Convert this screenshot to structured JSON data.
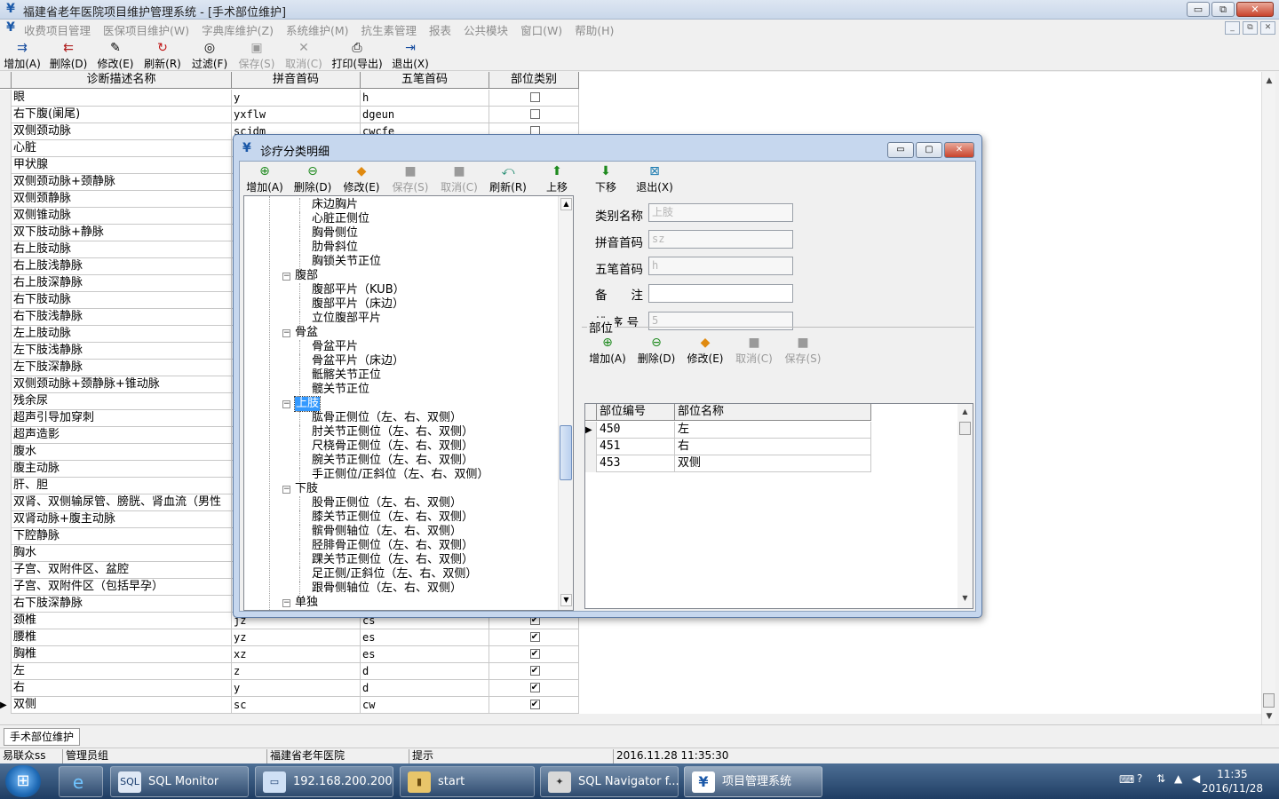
{
  "window": {
    "title": "福建省老年医院项目维护管理系统 - [手术部位维护]",
    "controls": [
      "▭",
      "⧉",
      "✕"
    ]
  },
  "menu": {
    "items": [
      "收费项目管理",
      "医保项目维护(W)",
      "字典库维护(Z)",
      "系统维护(M)",
      "抗生素管理",
      "报表",
      "公共模块",
      "窗口(W)",
      "帮助(H)"
    ],
    "mdi_controls": [
      "_",
      "⧉",
      "✕"
    ]
  },
  "toolbar": {
    "add": "增加(A)",
    "delete": "删除(D)",
    "edit": "修改(E)",
    "refresh": "刷新(R)",
    "filter": "过滤(F)",
    "save": "保存(S)",
    "cancel": "取消(C)",
    "print": "打印(导出)",
    "exit": "退出(X)"
  },
  "main_grid": {
    "columns": [
      "诊断描述名称",
      "拼音首码",
      "五笔首码",
      "部位类别"
    ],
    "rows": [
      {
        "name": "眼",
        "py": "y",
        "wb": "h",
        "checked": false
      },
      {
        "name": "右下腹(阑尾)",
        "py": "yxflw",
        "wb": "dgeun",
        "checked": false
      },
      {
        "name": "双侧颈动脉",
        "py": "scjdm",
        "wb": "cwcfe",
        "checked": false
      },
      {
        "name": "心脏",
        "py": "",
        "wb": "",
        "checked": false
      },
      {
        "name": "甲状腺",
        "py": "",
        "wb": "",
        "checked": false
      },
      {
        "name": "双侧颈动脉+颈静脉",
        "py": "",
        "wb": "",
        "checked": false
      },
      {
        "name": "双侧颈静脉",
        "py": "",
        "wb": "",
        "checked": false
      },
      {
        "name": "双侧锥动脉",
        "py": "",
        "wb": "",
        "checked": false
      },
      {
        "name": "双下肢动脉+静脉",
        "py": "",
        "wb": "",
        "checked": false
      },
      {
        "name": "右上肢动脉",
        "py": "",
        "wb": "",
        "checked": false
      },
      {
        "name": "右上肢浅静脉",
        "py": "",
        "wb": "",
        "checked": false
      },
      {
        "name": "右上肢深静脉",
        "py": "",
        "wb": "",
        "checked": false
      },
      {
        "name": "右下肢动脉",
        "py": "",
        "wb": "",
        "checked": false
      },
      {
        "name": "右下肢浅静脉",
        "py": "",
        "wb": "",
        "checked": false
      },
      {
        "name": "左上肢动脉",
        "py": "",
        "wb": "",
        "checked": false
      },
      {
        "name": "左下肢浅静脉",
        "py": "",
        "wb": "",
        "checked": false
      },
      {
        "name": "左下肢深静脉",
        "py": "",
        "wb": "",
        "checked": false
      },
      {
        "name": "双侧颈动脉+颈静脉+锥动脉",
        "py": "",
        "wb": "",
        "checked": false
      },
      {
        "name": "残余尿",
        "py": "",
        "wb": "",
        "checked": false
      },
      {
        "name": "超声引导加穿刺",
        "py": "",
        "wb": "",
        "checked": false
      },
      {
        "name": "超声造影",
        "py": "",
        "wb": "",
        "checked": false
      },
      {
        "name": "腹水",
        "py": "",
        "wb": "",
        "checked": false
      },
      {
        "name": "腹主动脉",
        "py": "",
        "wb": "",
        "checked": false
      },
      {
        "name": "肝、胆",
        "py": "",
        "wb": "",
        "checked": false
      },
      {
        "name": "双肾、双侧输尿管、膀胱、肾血流（男性",
        "py": "",
        "wb": "",
        "checked": false
      },
      {
        "name": "双肾动脉+腹主动脉",
        "py": "",
        "wb": "",
        "checked": false
      },
      {
        "name": "下腔静脉",
        "py": "",
        "wb": "",
        "checked": false
      },
      {
        "name": "胸水",
        "py": "",
        "wb": "",
        "checked": false
      },
      {
        "name": "子宫、双附件区、盆腔",
        "py": "",
        "wb": "",
        "checked": false
      },
      {
        "name": "子宫、双附件区（包括早孕）",
        "py": "",
        "wb": "",
        "checked": false
      },
      {
        "name": "右下肢深静脉",
        "py": "",
        "wb": "",
        "checked": false
      },
      {
        "name": "颈椎",
        "py": "jz",
        "wb": "cs",
        "checked": true
      },
      {
        "name": "腰椎",
        "py": "yz",
        "wb": "es",
        "checked": true
      },
      {
        "name": "胸椎",
        "py": "xz",
        "wb": "es",
        "checked": true
      },
      {
        "name": "左",
        "py": "z",
        "wb": "d",
        "checked": true
      },
      {
        "name": "右",
        "py": "y",
        "wb": "d",
        "checked": true
      },
      {
        "name": "双侧",
        "py": "sc",
        "wb": "cw",
        "checked": true
      }
    ]
  },
  "dialog": {
    "title": "诊疗分类明细",
    "controls": [
      "▭",
      "▢",
      "✕"
    ],
    "toolbar": {
      "add": "增加(A)",
      "delete": "删除(D)",
      "edit": "修改(E)",
      "save": "保存(S)",
      "cancel": "取消(C)",
      "refresh": "刷新(R)",
      "up": "上移",
      "down": "下移",
      "exit": "退出(X)"
    },
    "tree": [
      {
        "text": "床边胸片",
        "level": 2
      },
      {
        "text": "心脏正侧位",
        "level": 2
      },
      {
        "text": "胸骨侧位",
        "level": 2
      },
      {
        "text": "肋骨斜位",
        "level": 2
      },
      {
        "text": "胸锁关节正位",
        "level": 2
      },
      {
        "text": "腹部",
        "level": 1
      },
      {
        "text": "腹部平片（KUB）",
        "level": 2
      },
      {
        "text": "腹部平片（床边）",
        "level": 2
      },
      {
        "text": "立位腹部平片",
        "level": 2
      },
      {
        "text": "骨盆",
        "level": 1
      },
      {
        "text": "骨盆平片",
        "level": 2
      },
      {
        "text": "骨盆平片（床边）",
        "level": 2
      },
      {
        "text": "骶髂关节正位",
        "level": 2
      },
      {
        "text": "髋关节正位",
        "level": 2
      },
      {
        "text": "上肢",
        "level": 1,
        "selected": true
      },
      {
        "text": "肱骨正侧位（左、右、双侧）",
        "level": 2
      },
      {
        "text": "肘关节正侧位（左、右、双侧）",
        "level": 2
      },
      {
        "text": "尺桡骨正侧位（左、右、双侧）",
        "level": 2
      },
      {
        "text": "腕关节正侧位（左、右、双侧）",
        "level": 2
      },
      {
        "text": "手正侧位/正斜位（左、右、双侧）",
        "level": 2
      },
      {
        "text": "下肢",
        "level": 1
      },
      {
        "text": "股骨正侧位（左、右、双侧）",
        "level": 2
      },
      {
        "text": "膝关节正侧位（左、右、双侧）",
        "level": 2
      },
      {
        "text": "髌骨侧轴位（左、右、双侧）",
        "level": 2
      },
      {
        "text": "胫腓骨正侧位（左、右、双侧）",
        "level": 2
      },
      {
        "text": "踝关节正侧位（左、右、双侧）",
        "level": 2
      },
      {
        "text": "足正侧/正斜位（左、右、双侧）",
        "level": 2
      },
      {
        "text": "跟骨侧轴位（左、右、双侧）",
        "level": 2
      },
      {
        "text": "单独",
        "level": 1
      }
    ],
    "form": {
      "category_label": "类别名称",
      "category_value": "上肢",
      "pinyin_label": "拼音首码",
      "pinyin_value": "sz",
      "wubi_label": "五笔首码",
      "wubi_value": "h",
      "remark_label": "备　　注",
      "remark_value": "",
      "order_label": "排 序 号",
      "order_value": "5"
    },
    "part_group": {
      "label": "部位",
      "toolbar": {
        "add": "增加(A)",
        "delete": "删除(D)",
        "edit": "修改(E)",
        "cancel": "取消(C)",
        "save": "保存(S)"
      },
      "columns": [
        "部位编号",
        "部位名称"
      ],
      "rows": [
        {
          "code": "450",
          "name": "左"
        },
        {
          "code": "451",
          "name": "右"
        },
        {
          "code": "453",
          "name": "双侧"
        }
      ]
    }
  },
  "tab": {
    "label": "手术部位维护"
  },
  "status": {
    "user": "易联众ss",
    "group": "管理员组",
    "hospital": "福建省老年医院",
    "hint": "提示",
    "datetime": "2016.11.28  11:35:30"
  },
  "taskbar": {
    "buttons": [
      "SQL Monitor",
      "192.168.200.200",
      "start",
      "SQL Navigator f...",
      "项目管理系统"
    ],
    "time": "11:35",
    "date": "2016/11/28"
  },
  "colors": {
    "accent": "#1a58a8",
    "dialog_frame": "#c6d7ee",
    "taskbar": "#1f3d63",
    "selection": "#3399ff"
  }
}
